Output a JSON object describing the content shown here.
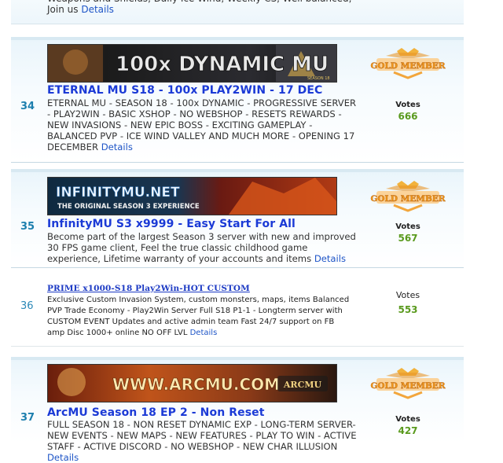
{
  "top_entry": {
    "desc": "Weapons and Shields, Daily Ice Wind, Weekly CS, Well balanced, Join us",
    "details": "Details"
  },
  "entries": [
    {
      "rank": "34",
      "banner_text": "100x DYNAMIC MU",
      "banner_logo": "MU",
      "banner_season": "SEASON 18",
      "title": "ETERNAL MU S18 - 100x PLAY2WIN - 17 DEC",
      "desc": "ETERNAL MU - SEASON 18 - 100x DYNAMIC - PROGRESSIVE SERVER - PLAY2WIN - BASIC XSHOP - NO WEBSHOP - RESETS REWARDS - NEW INVASIONS - NEW EPIC BOSS - EXCITING GAMEPLAY - BALANCED PVP - ICE WIND VALLEY AND MUCH MORE - OPENING 17 DECEMBER",
      "details": "Details",
      "badge": "GOLD MEMBER",
      "votes_label": "Votes",
      "votes": "666"
    },
    {
      "rank": "35",
      "banner_text": "INFINITYMU.NET",
      "banner_sub": "THE ORIGINAL SEASON 3 EXPERIENCE",
      "title": "InfinityMU S3 x9999 - Easy Start For All",
      "desc": "Become part of the largest Season 3 server with new and improved 30 FPS game client, Feel the true classic childhood game experience, Lifetime warranty of your accounts and items",
      "details": "Details",
      "badge": "GOLD MEMBER",
      "votes_label": "Votes",
      "votes": "567"
    },
    {
      "rank": "36",
      "title": "PRIME x1000-S18 Play2Win-HOT CUSTOM",
      "desc": "Exclusive Custom Invasion System, custom monsters, maps, items Balanced PVP Trade Economy - Play2Win Server Full S18 P1-1 - Longterm server with CUSTOM EVENT Updates and active admin team Fast 24/7 support on FB amp Disc 1000+ online NO OFF LVL",
      "details": "Details",
      "votes_label": "Votes",
      "votes": "553"
    },
    {
      "rank": "37",
      "banner_text": "WWW.ARCMU.COM",
      "banner_logo": "ARCMU",
      "title": "ArcMU Season 18 EP 2 - Non Reset",
      "desc": "FULL SEASON 18 - NON RESET DYNAMIC EXP - LONG-TERM SERVER- NEW EVENTS - NEW MAPS - NEW FEATURES - PLAY TO WIN - ACTIVE STAFF - ACTIVE DISCORD - NO WEBSHOP - NEW CHAR ILLUSION",
      "details": "Details",
      "badge": "GOLD MEMBER",
      "votes_label": "Votes",
      "votes": "427"
    }
  ],
  "colors": {
    "title": "#1b3ad6",
    "rank": "#1d7fae",
    "votes": "#5a9a1e",
    "gold_badge": "#f29a1c"
  }
}
